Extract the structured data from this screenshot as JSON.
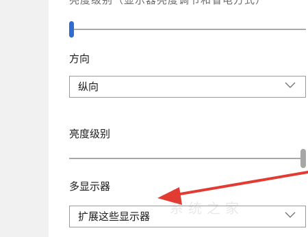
{
  "settings": {
    "top_text_cut": "亮度级别（显示器亮度调节和省电方式）",
    "orientation": {
      "label": "方向",
      "selected": "纵向"
    },
    "brightness": {
      "label": "亮度级别",
      "level_fraction": 1.0
    },
    "multiple_displays": {
      "label": "多显示器",
      "selected": "扩展这些显示器"
    },
    "top_slider_level_fraction": 0.0
  },
  "annotation": {
    "arrow_color": "#e23b32"
  },
  "watermark": {
    "text": "系统之家"
  },
  "colors": {
    "accent": "#2f6bd1",
    "slider_track": "#a8a8a8",
    "dropdown_border": "#9a9a9a",
    "left_rail": "#f1f1f1"
  }
}
